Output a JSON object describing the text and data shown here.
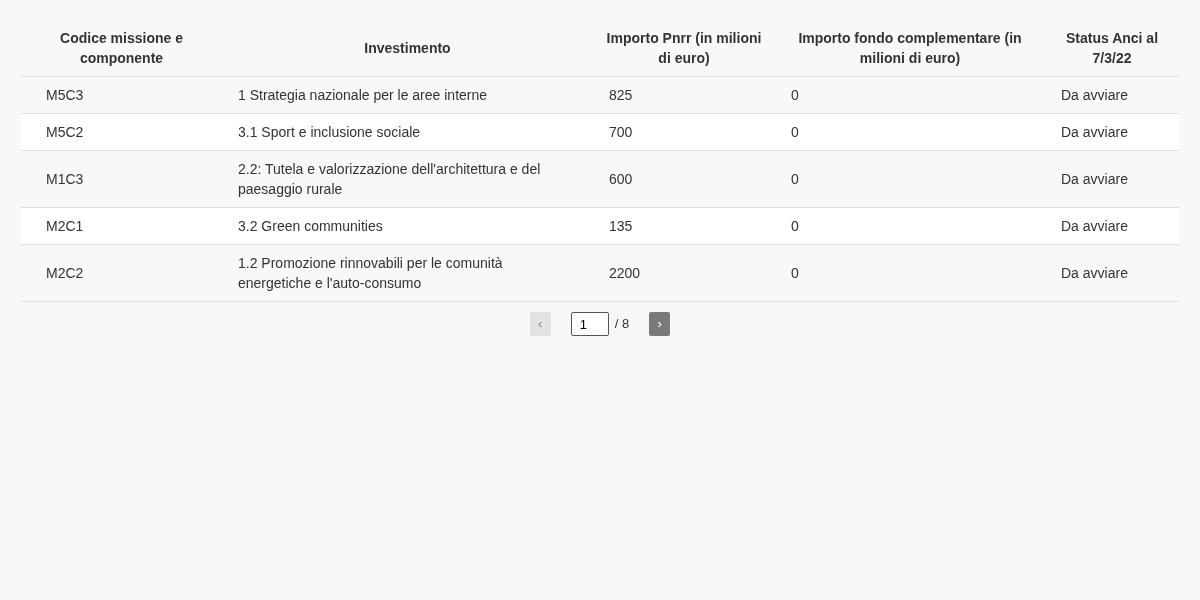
{
  "table": {
    "columns": [
      "Codice missione e componente",
      "Investimento",
      "Importo Pnrr (in milioni di euro)",
      "Importo fondo complementare (in milioni di euro)",
      "Status Anci al 7/3/22"
    ],
    "rows": [
      [
        "M5C3",
        "1 Strategia nazionale per le aree interne",
        "825",
        "0",
        "Da avviare"
      ],
      [
        "M5C2",
        "3.1 Sport e inclusione sociale",
        "700",
        "0",
        "Da avviare"
      ],
      [
        "M1C3",
        "2.2: Tutela e valorizzazione dell'architettura e del paesaggio rurale",
        "600",
        "0",
        "Da avviare"
      ],
      [
        "M2C1",
        "3.2 Green communities",
        "135",
        "0",
        "Da avviare"
      ],
      [
        "M2C2",
        "1.2 Promozione rinnovabili per le comunità energetiche e l'auto-consumo",
        "2200",
        "0",
        "Da avviare"
      ]
    ]
  },
  "pagination": {
    "prev": {
      "label": "‹",
      "disabled": true
    },
    "page": "1",
    "total": "/ 8",
    "next": {
      "label": "›",
      "disabled": false
    }
  }
}
